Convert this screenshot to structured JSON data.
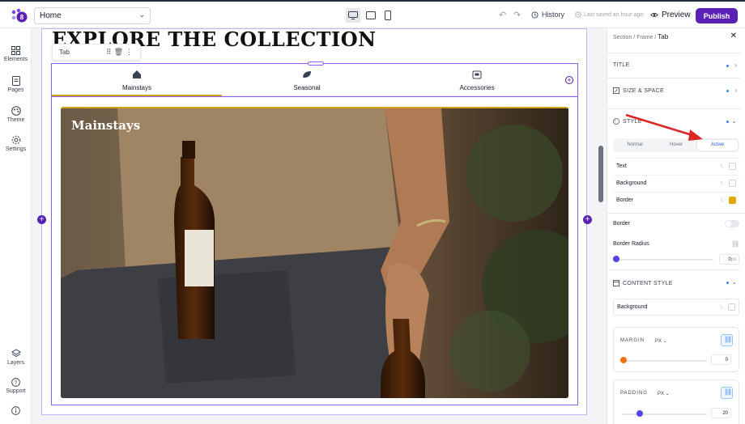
{
  "topbar": {
    "page_select": "Home",
    "history_label": "History",
    "saved_status": "Last saved an hour ago",
    "preview_label": "Preview",
    "publish_label": "Publish"
  },
  "leftrail": {
    "items": [
      {
        "label": "Elements",
        "icon": "grid-icon"
      },
      {
        "label": "Pages",
        "icon": "page-icon"
      },
      {
        "label": "Theme",
        "icon": "palette-icon"
      },
      {
        "label": "Settings",
        "icon": "gear-icon"
      },
      {
        "label": "Layers",
        "icon": "layers-icon"
      },
      {
        "label": "Support",
        "icon": "help-icon"
      }
    ]
  },
  "canvas": {
    "heading": "EXPLORE THE COLLECTION",
    "tab_chip_label": "Tab",
    "tabs": [
      {
        "label": "Mainstays",
        "icon": "home-icon",
        "active": true
      },
      {
        "label": "Seasonal",
        "icon": "leaf-icon",
        "active": false
      },
      {
        "label": "Accessories",
        "icon": "bag-icon",
        "active": false
      }
    ],
    "hero_title": "Mainstays"
  },
  "panel": {
    "breadcrumb": [
      "Section",
      "Frame"
    ],
    "breadcrumb_current": "Tab",
    "sections": {
      "title": "TITLE",
      "size_space": "SIZE & SPACE",
      "style": "STYLE",
      "content_style": "CONTENT STYLE"
    },
    "state_tabs": [
      "Normal",
      "Hover",
      "Active"
    ],
    "active_state": "Active",
    "style_props": [
      {
        "label": "Text",
        "swatch": "#ffffff"
      },
      {
        "label": "Background",
        "swatch": "#ffffff"
      },
      {
        "label": "Border",
        "swatch": "#e5a80c"
      }
    ],
    "border_label": "Border",
    "border_radius_label": "Border Radius",
    "border_radius_value": "0",
    "border_radius_unit": "px",
    "content_background_label": "Background",
    "margin": {
      "title": "MARGIN",
      "unit": "PX",
      "value": "0"
    },
    "padding": {
      "title": "PADDING",
      "unit": "PX",
      "value": "20"
    }
  },
  "colors": {
    "accent": "#5b21b6",
    "tab_underline": "#d4a017",
    "selection": "#8b5cf6",
    "arrow": "#dc2626"
  }
}
